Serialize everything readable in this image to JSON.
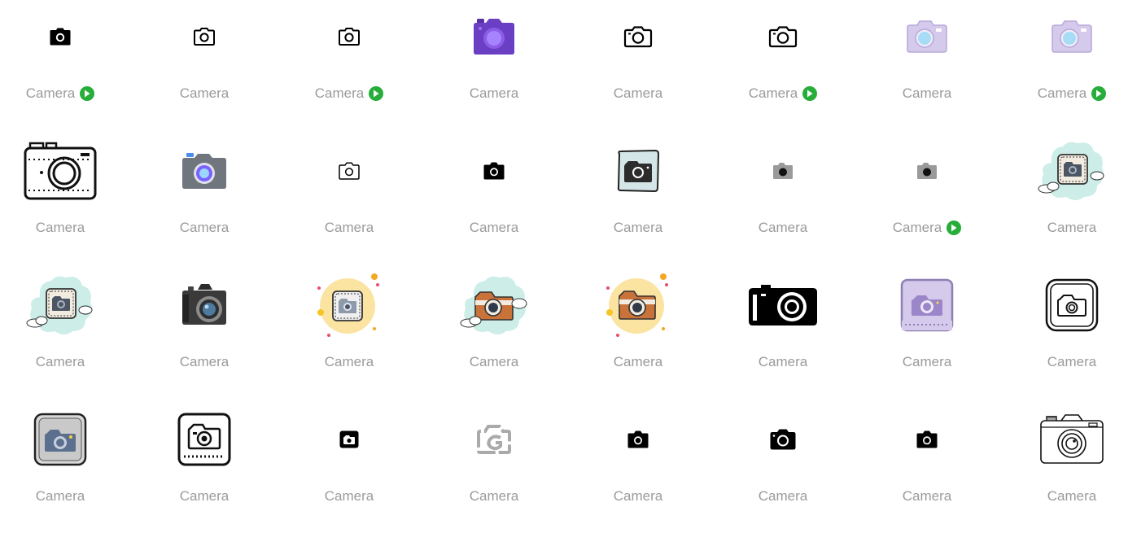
{
  "colors": {
    "label": "#9b9b9b",
    "play_badge": "#27ae3a",
    "purple": "#6a3fc4",
    "lavender": "#d5c9ec",
    "sky_lens": "#a6dcf5",
    "cloud_mint": "#cdeee8",
    "sunny_yellow": "#fbe3a2",
    "camera_brown": "#c9733a"
  },
  "icons": [
    {
      "label": "Camera",
      "icon": "camera-solid-icon",
      "has_play": true
    },
    {
      "label": "Camera",
      "icon": "camera-outline-bold-icon",
      "has_play": false
    },
    {
      "label": "Camera",
      "icon": "camera-outline-bold-icon",
      "has_play": true
    },
    {
      "label": "Camera",
      "icon": "camera-purple-icon",
      "has_play": false
    },
    {
      "label": "Camera",
      "icon": "camera-outline-icon",
      "has_play": false
    },
    {
      "label": "Camera",
      "icon": "camera-outline-icon",
      "has_play": true
    },
    {
      "label": "Camera",
      "icon": "camera-lavender-icon",
      "has_play": false
    },
    {
      "label": "Camera",
      "icon": "camera-lavender-icon",
      "has_play": true
    },
    {
      "label": "Camera",
      "icon": "film-camera-lineart-icon",
      "has_play": false
    },
    {
      "label": "Camera",
      "icon": "camera-gray-color-icon",
      "has_play": false
    },
    {
      "label": "Camera",
      "icon": "camera-thin-outline-icon",
      "has_play": false
    },
    {
      "label": "Camera",
      "icon": "camera-solid-small-icon",
      "has_play": false
    },
    {
      "label": "Camera",
      "icon": "camera-sketch-frame-icon",
      "has_play": false
    },
    {
      "label": "Camera",
      "icon": "camera-gray-small-icon",
      "has_play": false
    },
    {
      "label": "Camera",
      "icon": "camera-gray-small-icon",
      "has_play": true
    },
    {
      "label": "Camera",
      "icon": "camera-cloud-frame-icon",
      "has_play": false
    },
    {
      "label": "Camera",
      "icon": "camera-cloud-frame-icon",
      "has_play": false
    },
    {
      "label": "Camera",
      "icon": "dslr-camera-icon",
      "has_play": false
    },
    {
      "label": "Camera",
      "icon": "camera-sunny-frame-icon",
      "has_play": false
    },
    {
      "label": "Camera",
      "icon": "camera-brown-cloud-icon",
      "has_play": false
    },
    {
      "label": "Camera",
      "icon": "camera-brown-sunny-icon",
      "has_play": false
    },
    {
      "label": "Camera",
      "icon": "camera-bold-wide-icon",
      "has_play": false
    },
    {
      "label": "Camera",
      "icon": "camera-purple-square-icon",
      "has_play": false
    },
    {
      "label": "Camera",
      "icon": "camera-rounded-square-outline-icon",
      "has_play": false
    },
    {
      "label": "Camera",
      "icon": "camera-gray-square-icon",
      "has_play": false
    },
    {
      "label": "Camera",
      "icon": "camera-square-frame-icon",
      "has_play": false
    },
    {
      "label": "Camera",
      "icon": "camera-tiny-solid-icon",
      "has_play": false
    },
    {
      "label": "Camera",
      "icon": "camera-abstract-gray-icon",
      "has_play": false
    },
    {
      "label": "Camera",
      "icon": "camera-solid-small-icon",
      "has_play": false
    },
    {
      "label": "Camera",
      "icon": "camera-solid-rounded-icon",
      "has_play": false
    },
    {
      "label": "Camera",
      "icon": "camera-solid-small-icon",
      "has_play": false
    },
    {
      "label": "Camera",
      "icon": "camera-thin-lineart-icon",
      "has_play": false
    }
  ]
}
